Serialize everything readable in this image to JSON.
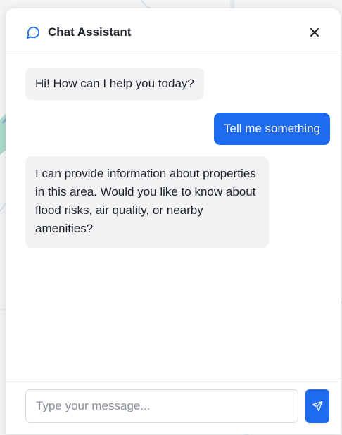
{
  "header": {
    "title": "Chat Assistant",
    "chat_icon": "chat-bubble-icon",
    "close_icon": "close-icon"
  },
  "messages": [
    {
      "role": "assistant",
      "text": "Hi! How can I help you today?"
    },
    {
      "role": "user",
      "text": "Tell me something"
    },
    {
      "role": "assistant",
      "text": "I can provide information about properties in this area. Would you like to know about flood risks, air quality, or nearby amenities?"
    }
  ],
  "input": {
    "value": "",
    "placeholder": "Type your message...",
    "send_icon": "send-icon"
  },
  "colors": {
    "accent": "#1f6bef",
    "assistant_bubble": "#f1f2f4",
    "text": "#1f2328"
  }
}
